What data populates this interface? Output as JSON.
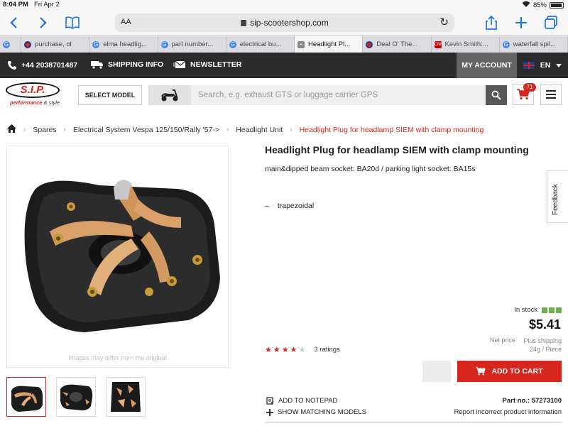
{
  "status_bar": {
    "time": "8:04 PM",
    "date": "Fri Apr 2",
    "battery": "85%"
  },
  "browser": {
    "aa_label": "AA",
    "url": "sip-scootershop.com",
    "tabs": [
      {
        "label": "purchase, ol"
      },
      {
        "label": "elma headlig..."
      },
      {
        "label": "part number..."
      },
      {
        "label": "electrical bu..."
      },
      {
        "label": "Headlight Pl..."
      },
      {
        "label": "Deal O' The..."
      },
      {
        "label": "Kevin Smith:..."
      },
      {
        "label": "waterfall spil..."
      }
    ]
  },
  "topbar": {
    "phone": "+44 2038701487",
    "shipping_info": "SHIPPING INFO",
    "newsletter": "NEWSLETTER",
    "my_account": "MY ACCOUNT",
    "language": "EN"
  },
  "header": {
    "logo_text": "S.I.P.",
    "logo_tagline_a": "performance",
    "logo_tagline_b": "& style",
    "select_model": "SELECT MODEL",
    "search_placeholder": "Search, e.g. exhaust GTS or luggage carrier GPS",
    "cart_count": "71"
  },
  "breadcrumb": {
    "items": [
      "Spares",
      "Electrical System Vespa 125/150/Rally '57->",
      "Headlight Unit"
    ],
    "current": "Headlight Plug for headlamp SIEM with clamp mounting"
  },
  "product": {
    "title": "Headlight Plug for headlamp SIEM with clamp mounting",
    "subtitle": "main&dipped beam socket: BA20d / parking light socket: BA15s",
    "feature_dash": "–",
    "feature": "trapezoidal",
    "image_note": "Images may differ from the original",
    "stock": "In stock",
    "price": "$5.41",
    "net_price": "Net price",
    "shipping_line1": "Plus shipping",
    "shipping_line2": "24g / Piece",
    "rating_value": 4,
    "ratings_count": "3 ratings",
    "add_to_cart": "ADD TO CART",
    "add_to_notepad": "ADD TO NOTEPAD",
    "show_matching": "SHOW MATCHING MODELS",
    "part_no_label": "Part no.:",
    "part_no": "57273100",
    "report": "Report incorrect product information"
  },
  "feedback_tab": "Feedback",
  "colors": {
    "accent": "#d7261e",
    "topbar": "#2b2b2b",
    "stock_green": "#6ab04c"
  }
}
